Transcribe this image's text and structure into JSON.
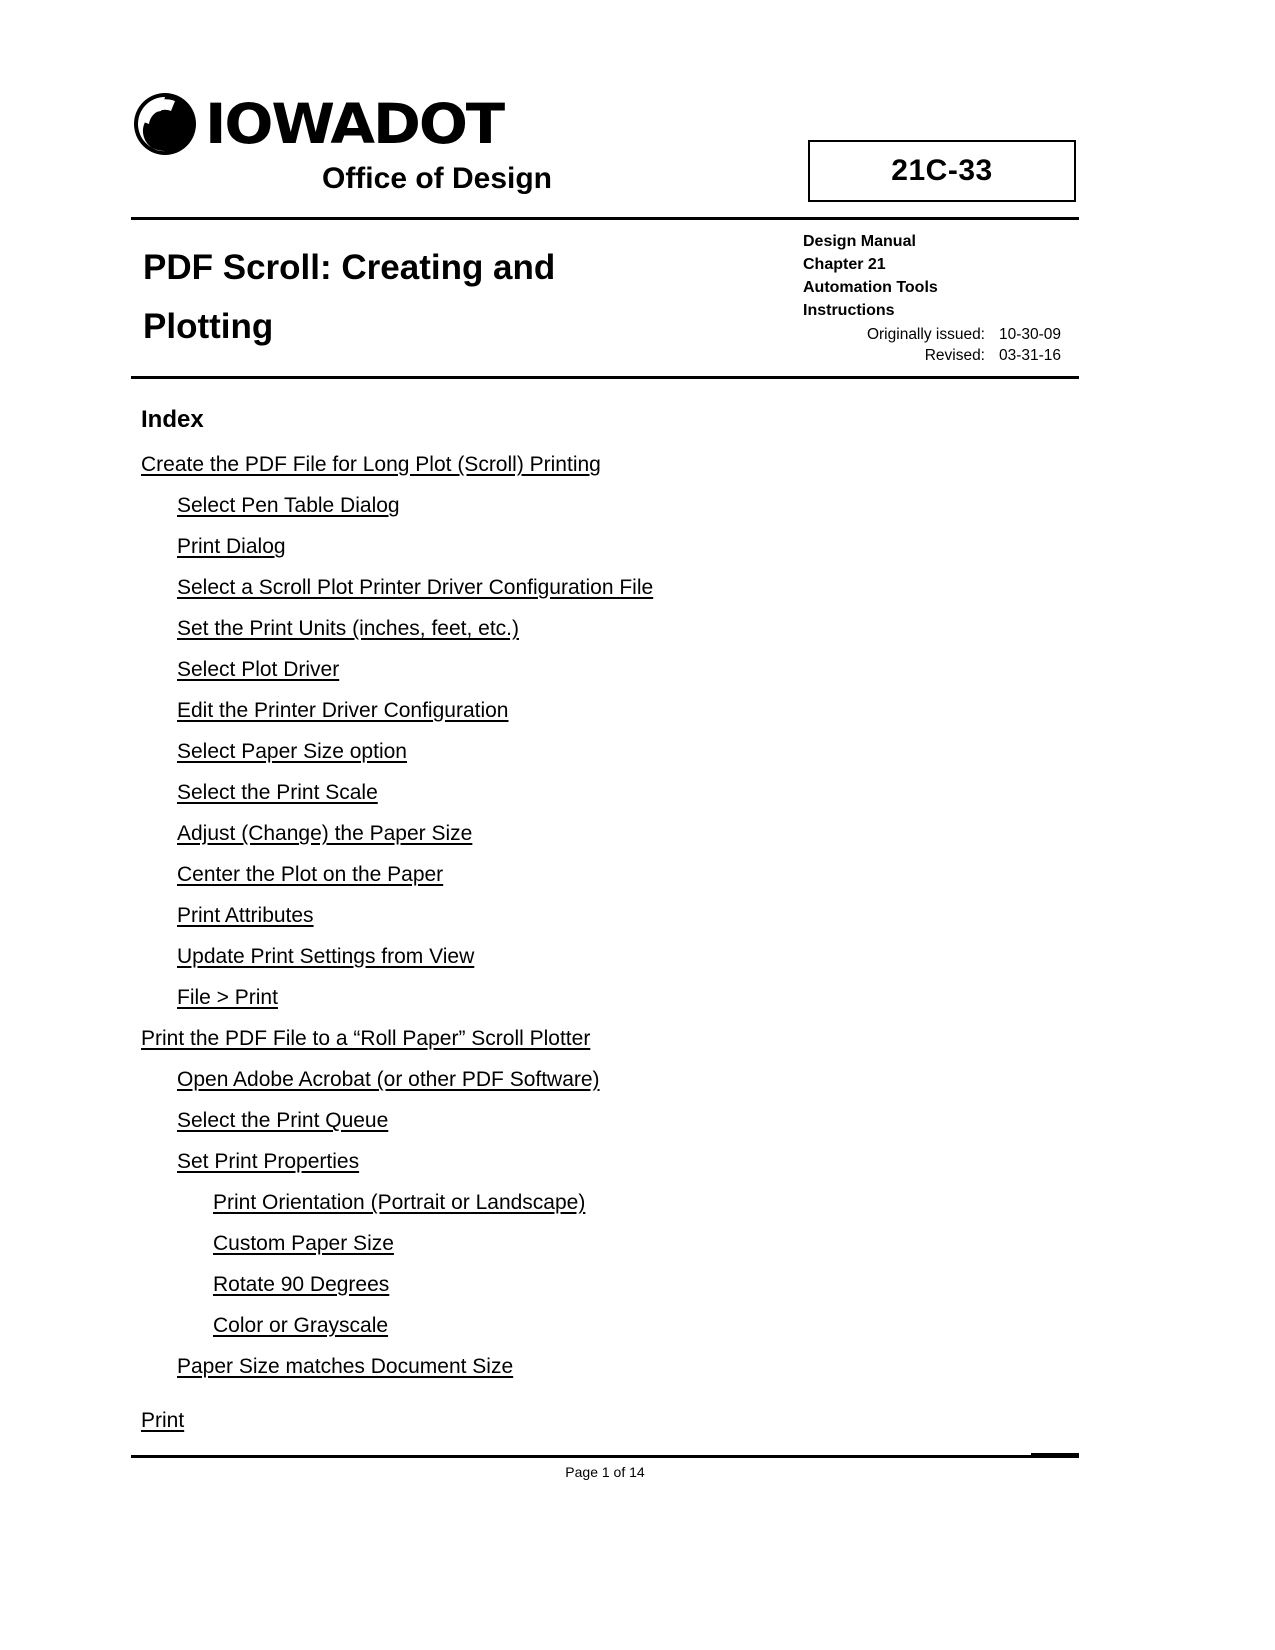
{
  "header": {
    "logo_word": "IOWADOT",
    "logo_icon": "iowa-dot-swoosh-logo",
    "office_line": "Office of Design",
    "doc_number": "21C-33"
  },
  "title": {
    "line1": "PDF Scroll: Creating and",
    "line2": "Plotting"
  },
  "meta": {
    "manual": "Design Manual",
    "chapter": "Chapter 21",
    "section": "Automation Tools",
    "subsection": "Instructions",
    "originally_issued_label": "Originally issued:",
    "originally_issued_value": "10-30-09",
    "revised_label": "Revised:",
    "revised_value": "03-31-16"
  },
  "index": {
    "heading": "Index",
    "items": [
      {
        "label": "Create the PDF File for Long Plot (Scroll) Printing",
        "level": 0,
        "gap": false
      },
      {
        "label": "Select Pen Table Dialog",
        "level": 1,
        "gap": false
      },
      {
        "label": "Print Dialog",
        "level": 1,
        "gap": false
      },
      {
        "label": "Select a Scroll Plot Printer Driver Configuration File",
        "level": 1,
        "gap": false
      },
      {
        "label": "Set the Print Units (inches, feet, etc.)",
        "level": 1,
        "gap": false
      },
      {
        "label": "Select Plot Driver",
        "level": 1,
        "gap": false
      },
      {
        "label": "Edit the Printer Driver Configuration",
        "level": 1,
        "gap": false
      },
      {
        "label": "Select Paper Size option",
        "level": 1,
        "gap": false
      },
      {
        "label": "Select the Print Scale",
        "level": 1,
        "gap": false
      },
      {
        "label": "Adjust (Change) the Paper Size",
        "level": 1,
        "gap": false
      },
      {
        "label": "Center the Plot on the Paper",
        "level": 1,
        "gap": false
      },
      {
        "label": "Print Attributes",
        "level": 1,
        "gap": false
      },
      {
        "label": "Update Print Settings from View",
        "level": 1,
        "gap": false
      },
      {
        "label": "File > Print",
        "level": 1,
        "gap": false
      },
      {
        "label": "Print the PDF File to a “Roll Paper” Scroll Plotter",
        "level": 0,
        "gap": false
      },
      {
        "label": "Open Adobe Acrobat (or other PDF Software)",
        "level": 1,
        "gap": false
      },
      {
        "label": "Select the Print Queue",
        "level": 1,
        "gap": false
      },
      {
        "label": "Set Print Properties",
        "level": 1,
        "gap": false
      },
      {
        "label": "Print Orientation (Portrait or Landscape)",
        "level": 2,
        "gap": false
      },
      {
        "label": "Custom Paper Size",
        "level": 2,
        "gap": false
      },
      {
        "label": "Rotate 90 Degrees",
        "level": 2,
        "gap": false
      },
      {
        "label": "Color or Grayscale",
        "level": 2,
        "gap": false
      },
      {
        "label": "Paper Size matches Document Size",
        "level": 1,
        "gap": false
      },
      {
        "label": "Print",
        "level": 0,
        "gap": true
      }
    ]
  },
  "footer": {
    "page_text": "Page 1 of 14"
  },
  "colors": {
    "ink": "#000000",
    "paper": "#ffffff"
  }
}
